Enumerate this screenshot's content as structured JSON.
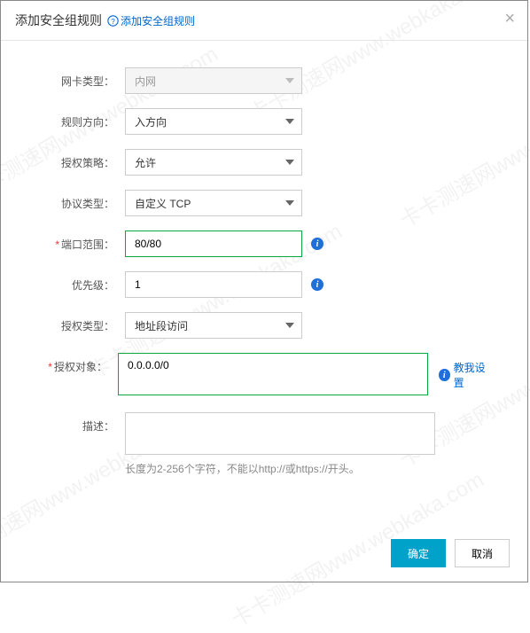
{
  "header": {
    "title": "添加安全组规则",
    "help_text": "添加安全组规则"
  },
  "form": {
    "nic_type": {
      "label": "网卡类型：",
      "value": "内网"
    },
    "direction": {
      "label": "规则方向：",
      "value": "入方向"
    },
    "policy": {
      "label": "授权策略：",
      "value": "允许"
    },
    "protocol": {
      "label": "协议类型：",
      "value": "自定义 TCP"
    },
    "port_range": {
      "label": "端口范围：",
      "value": "80/80"
    },
    "priority": {
      "label": "优先级：",
      "value": "1"
    },
    "auth_type": {
      "label": "授权类型：",
      "value": "地址段访问"
    },
    "auth_object": {
      "label": "授权对象：",
      "value": "0.0.0.0/0",
      "teach": "教我设置"
    },
    "description": {
      "label": "描述：",
      "value": "",
      "hint": "长度为2-256个字符，不能以http://或https://开头。"
    }
  },
  "footer": {
    "confirm": "确定",
    "cancel": "取消"
  },
  "watermark": "卡卡测速网www.webkaka.com"
}
